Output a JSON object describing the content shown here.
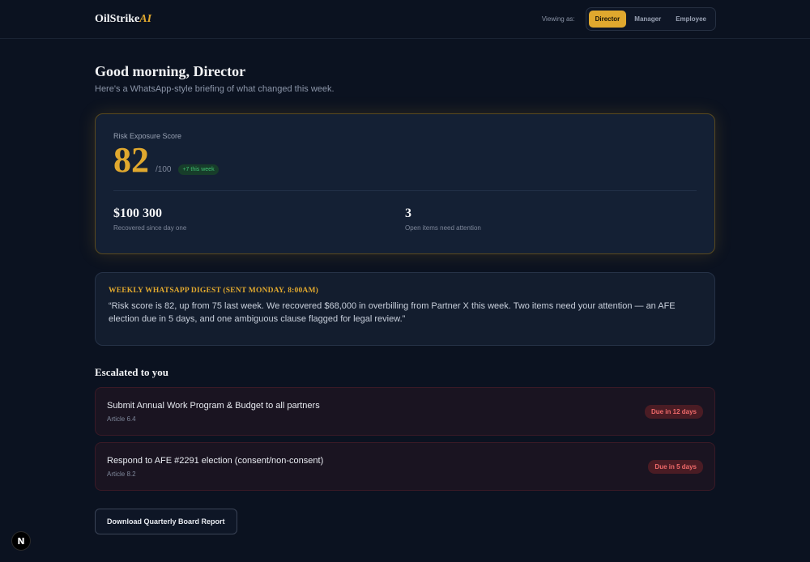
{
  "header": {
    "logo_main": "OilStrike",
    "logo_accent": "AI",
    "viewing_label": "Viewing as:",
    "roles": [
      "Director",
      "Manager",
      "Employee"
    ],
    "active_role": "Director"
  },
  "greeting": {
    "title": "Good morning, Director",
    "subtitle": "Here's a WhatsApp-style briefing of what changed this week."
  },
  "risk": {
    "label": "Risk Exposure Score",
    "score": "82",
    "max": "/100",
    "change": "+7 this week",
    "stats": [
      {
        "value": "$100 300",
        "label": "Recovered since day one"
      },
      {
        "value": "3",
        "label": "Open items need attention"
      }
    ]
  },
  "digest": {
    "title": "WEEKLY WHATSAPP DIGEST (SENT MONDAY, 8:00AM)",
    "body": "“Risk score is 82, up from 75 last week. We recovered $68,000 in overbilling from Partner X this week. Two items need your attention — an AFE election due in 5 days, and one ambiguous clause flagged for legal review.”"
  },
  "escalated": {
    "title": "Escalated to you",
    "items": [
      {
        "title": "Submit Annual Work Program & Budget to all partners",
        "article": "Article 6.4",
        "due": "Due in 12 days"
      },
      {
        "title": "Respond to AFE #2291 election (consent/non-consent)",
        "article": "Article 8.2",
        "due": "Due in 5 days"
      }
    ]
  },
  "actions": {
    "download_label": "Download Quarterly Board Report"
  },
  "dev_badge": "N",
  "colors": {
    "accent": "#e0a82e",
    "background": "#0b1220",
    "danger": "#f06a6a",
    "success": "#3fbf72"
  }
}
